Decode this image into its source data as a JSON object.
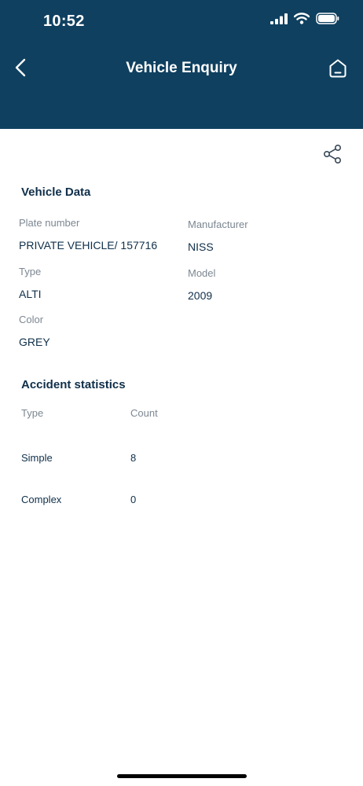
{
  "status_bar": {
    "time": "10:52"
  },
  "header": {
    "title": "Vehicle Enquiry"
  },
  "vehicle_data": {
    "title": "Vehicle Data",
    "plate_number": {
      "label": "Plate number",
      "value": "PRIVATE VEHICLE/ 157716"
    },
    "manufacturer": {
      "label": "Manufacturer",
      "value": "NISS"
    },
    "type": {
      "label": "Type",
      "value": "ALTI"
    },
    "model": {
      "label": "Model",
      "value": "2009"
    },
    "color": {
      "label": "Color",
      "value": "GREY"
    }
  },
  "accident_statistics": {
    "title": "Accident statistics",
    "headers": {
      "type": "Type",
      "count": "Count"
    },
    "rows": [
      {
        "type": "Simple",
        "count": "8"
      },
      {
        "type": "Complex",
        "count": "0"
      }
    ]
  },
  "colors": {
    "header_bg": "#0f4060",
    "text_dark": "#0f2f4a",
    "label_gray": "#7c8792"
  },
  "icons": {
    "back": "chevron-left-icon",
    "home": "home-icon",
    "share": "share-icon",
    "signal": "cellular-signal-icon",
    "wifi": "wifi-icon",
    "battery": "battery-icon"
  }
}
